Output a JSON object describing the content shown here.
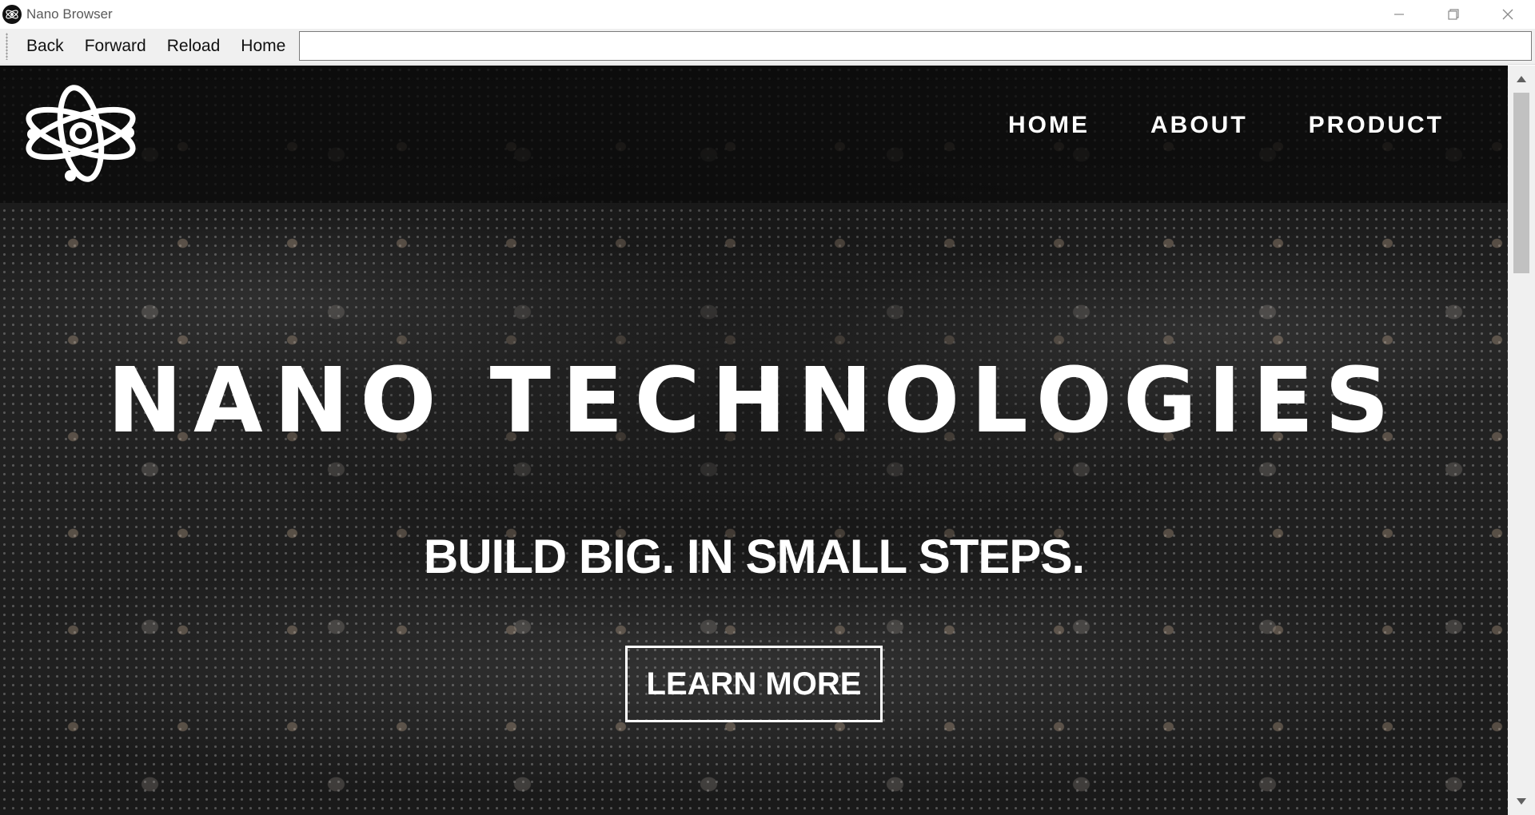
{
  "window": {
    "title": "Nano Browser",
    "app_icon": "atom-icon",
    "controls": {
      "minimize_icon": "minimize-icon",
      "restore_icon": "restore-icon",
      "close_icon": "close-icon"
    }
  },
  "toolbar": {
    "back_label": "Back",
    "forward_label": "Forward",
    "reload_label": "Reload",
    "home_label": "Home",
    "url_value": ""
  },
  "site": {
    "logo": "atom-logo",
    "nav": [
      {
        "label": "HOME"
      },
      {
        "label": "ABOUT"
      },
      {
        "label": "PRODUCT"
      }
    ],
    "hero_title": "NANO TECHNOLOGIES",
    "hero_subtitle": "BUILD BIG. IN SMALL STEPS.",
    "cta_label": "LEARN MORE"
  },
  "colors": {
    "hero_text": "#ffffff",
    "header_bg": "#0a0a0a",
    "toolbar_bg": "#f0f0f0"
  }
}
